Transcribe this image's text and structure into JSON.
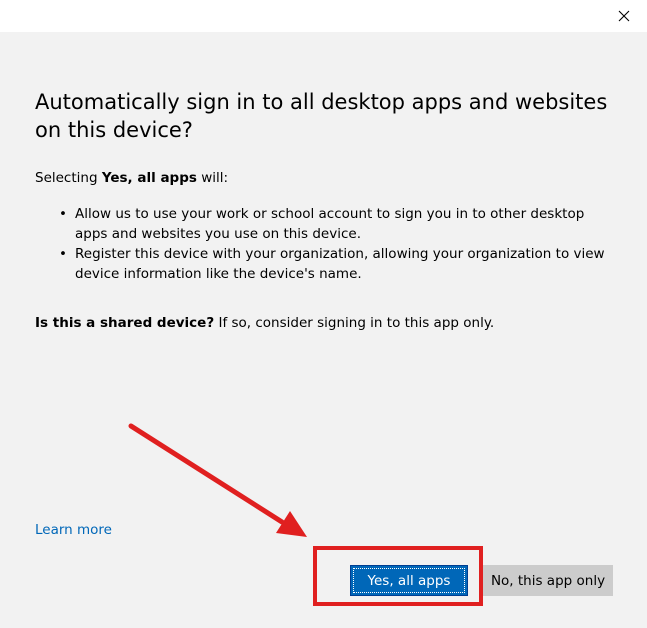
{
  "dialog": {
    "heading": "Automatically sign in to all desktop apps and websites on this device?",
    "intro_prefix": "Selecting ",
    "intro_bold": "Yes, all apps",
    "intro_suffix": " will:",
    "bullets": [
      "Allow us to use your work or school account to sign you in to other desktop apps and websites you use on this device.",
      "Register this device with your organization, allowing your organization to view device information like the device's name."
    ],
    "shared_bold": "Is this a shared device?",
    "shared_rest": " If so, consider signing in to this app only.",
    "learn_more": "Learn more",
    "primary_button": "Yes, all apps",
    "secondary_button": "No, this app only"
  },
  "icons": {
    "close": "close-icon"
  },
  "colors": {
    "background": "#f2f2f2",
    "titlebar": "#ffffff",
    "primary": "#0067b8",
    "secondary": "#cccccc",
    "link": "#0067b8",
    "annotation": "#e02020"
  }
}
